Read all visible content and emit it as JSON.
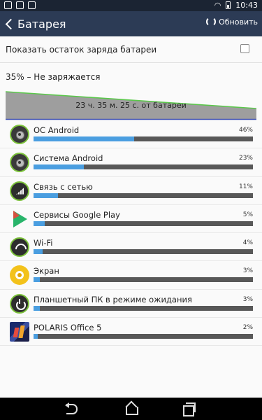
{
  "status_bar": {
    "time": "10:43",
    "left_icons": [
      "photo-icon",
      "shopping-bag-icon",
      "checkbox-icon"
    ],
    "right_icons": [
      "wifi-icon",
      "battery-icon"
    ]
  },
  "action_bar": {
    "title": "Батарея",
    "refresh_label": "Обновить"
  },
  "show_percentage": {
    "label": "Показать остаток заряда батареи",
    "checked": false
  },
  "charge_status": "35% – Не заряжается",
  "battery_graph": {
    "label": "23 ч. 35 м. 25 с. от батареи",
    "level_percent": 35,
    "line_color": "#5bc74b",
    "fill_color": "#9e9e9e",
    "baseline_color": "#3f51b5"
  },
  "usage": [
    {
      "name": "ОС Android",
      "percent": "46%",
      "value": 46,
      "icon": "android-os-icon",
      "icon_class": "icon-android"
    },
    {
      "name": "Система Android",
      "percent": "23%",
      "value": 23,
      "icon": "android-system-icon",
      "icon_class": "icon-android"
    },
    {
      "name": "Связь с сетью",
      "percent": "11%",
      "value": 11,
      "icon": "cell-signal-icon",
      "icon_class": "icon-signal"
    },
    {
      "name": "Сервисы Google Play",
      "percent": "5%",
      "value": 5,
      "icon": "google-play-icon",
      "icon_class": "icon-play"
    },
    {
      "name": "Wi-Fi",
      "percent": "4%",
      "value": 4,
      "icon": "wifi-icon",
      "icon_class": "icon-wifi"
    },
    {
      "name": "Экран",
      "percent": "3%",
      "value": 3,
      "icon": "screen-brightness-icon",
      "icon_class": "icon-screen"
    },
    {
      "name": "Планшетный ПК в режиме ожидания",
      "percent": "3%",
      "value": 3,
      "icon": "standby-power-icon",
      "icon_class": "icon-standby"
    },
    {
      "name": "POLARIS Office 5",
      "percent": "2%",
      "value": 2,
      "icon": "polaris-office-icon",
      "icon_class": "icon-polaris"
    }
  ],
  "colors": {
    "action_bar": "#2c3b55",
    "status_bar": "#1b2433",
    "bar_fill": "#4a9ee0",
    "bar_track": "#585858"
  },
  "nav_bar": {
    "icons": [
      "back-icon",
      "home-icon",
      "recent-apps-icon"
    ]
  }
}
